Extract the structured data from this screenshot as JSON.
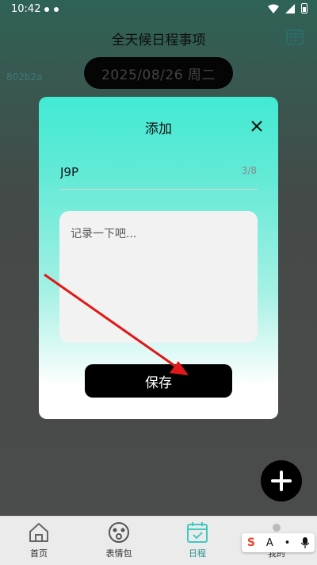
{
  "status_bar": {
    "time": "10:42"
  },
  "header": {
    "title": "全天候日程事项",
    "calendar_icon": "calendar-icon"
  },
  "color_code": "802b2a",
  "date_pill": {
    "text": "2025/08/26 周二"
  },
  "modal": {
    "title": "添加",
    "name_value": "J9P",
    "counter": "3/8",
    "note_placeholder": "记录一下吧...",
    "save_label": "保存"
  },
  "nav": {
    "items": [
      {
        "label": "首页",
        "icon": "home-icon",
        "active": false
      },
      {
        "label": "表情包",
        "icon": "emoji-icon",
        "active": false
      },
      {
        "label": "日程",
        "icon": "calendar-check-icon",
        "active": true
      },
      {
        "label": "我的",
        "icon": "profile-icon",
        "active": false
      }
    ]
  },
  "ime": {
    "s": "S",
    "a": "A",
    "dots": "•",
    "mic": "mic-icon"
  },
  "colors": {
    "accent": "#42ead3",
    "active_nav": "#2a8f8f",
    "annotation_arrow": "#e01818"
  }
}
